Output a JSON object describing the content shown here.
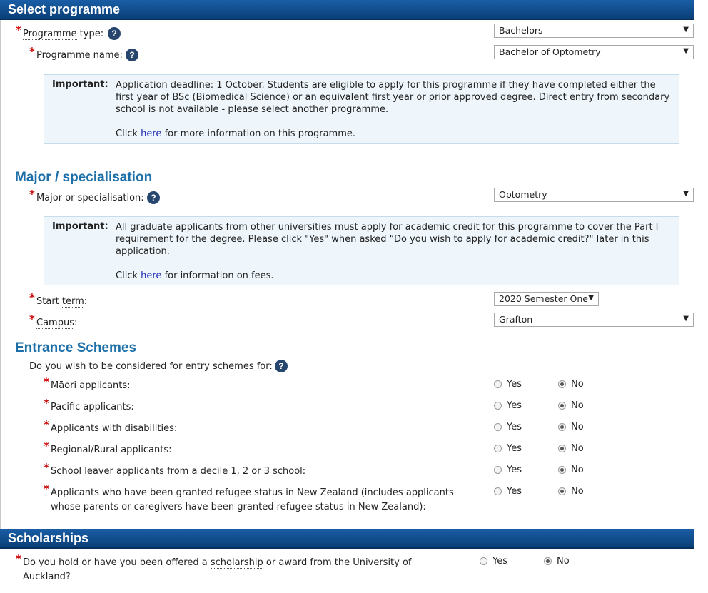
{
  "sections": {
    "select_programme": "Select programme",
    "major": "Major / specialisation",
    "entrance": "Entrance Schemes",
    "scholarships": "Scholarships"
  },
  "programme": {
    "type_label": "Programme",
    "type_label2": "type:",
    "type_value": "Bachelors",
    "name_label": "Programme name:",
    "name_value": "Bachelor of Optometry"
  },
  "notice1": {
    "important": "Important:",
    "text": "Application deadline: 1 October. Students are eligible to apply for this programme if they have completed either the first year of BSc (Biomedical Science) or an equivalent first year or prior approved degree. Direct entry from secondary school is not available - please select another programme.",
    "click": "Click",
    "link": "here",
    "after": "for more information on this programme."
  },
  "major": {
    "label": "Major or specialisation:",
    "value": "Optometry"
  },
  "notice2": {
    "important": "Important:",
    "text": "All graduate applicants from other universities must apply for academic credit for this programme to cover the Part I requirement for the degree. Please click \"Yes\" when asked “Do you wish to apply for academic credit?\" later in this application.",
    "click": "Click",
    "link": "here",
    "after": "for information on fees."
  },
  "start_term": {
    "label1": "Start",
    "label2": "term",
    "label3": ":",
    "value": "2020 Semester One"
  },
  "campus": {
    "label": "Campus",
    "colon": ":",
    "value": "Grafton"
  },
  "entrance": {
    "question": "Do you wish to be considered for entry schemes for:",
    "yes": "Yes",
    "no": "No",
    "items": [
      "Māori applicants:",
      "Pacific applicants:",
      "Applicants with disabilities:",
      "Regional/Rural applicants:",
      "School leaver applicants from a decile 1, 2 or 3 school:",
      "Applicants who have been granted refugee status in New Zealand (includes applicants",
      "whose parents or caregivers have been granted refugee status in New Zealand):"
    ]
  },
  "scholarship": {
    "q1": "Do you hold or have you been offered a",
    "q2": "scholarship",
    "q3": "or award from the University of",
    "q4": "Auckland?",
    "yes": "Yes",
    "no": "No"
  },
  "help_glyph": "?",
  "required_glyph": "*",
  "dropdown_glyph": "▼"
}
